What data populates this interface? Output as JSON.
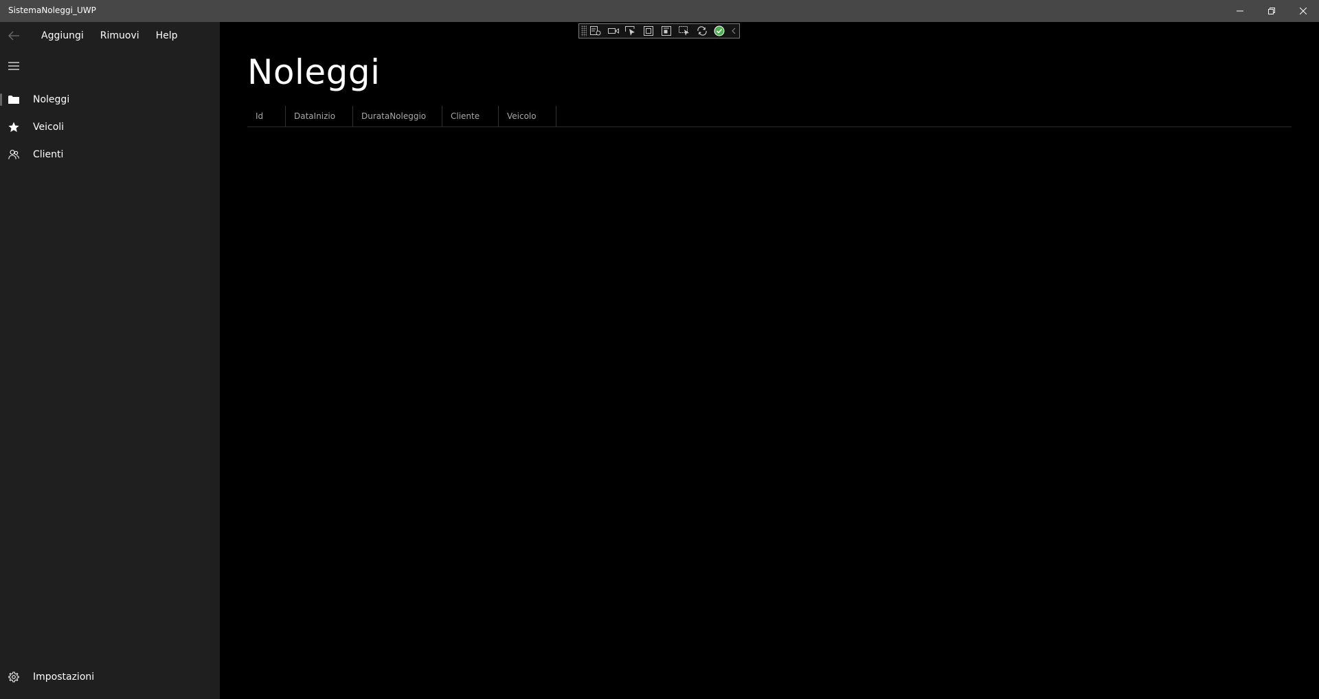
{
  "window": {
    "title": "SistemaNoleggi_UWP",
    "controls": [
      "minimize-icon",
      "restore-icon",
      "close-icon"
    ]
  },
  "menubar": {
    "items": [
      {
        "label": "Aggiungi"
      },
      {
        "label": "Rimuovi"
      },
      {
        "label": "Help"
      }
    ]
  },
  "navigation": {
    "items": [
      {
        "label": "Noleggi",
        "icon": "folder-icon",
        "selected": true
      },
      {
        "label": "Veicoli",
        "icon": "star-icon",
        "selected": false
      },
      {
        "label": "Clienti",
        "icon": "people-icon",
        "selected": false
      }
    ],
    "footer": {
      "label": "Impostazioni",
      "icon": "gear-icon"
    }
  },
  "page": {
    "title": "Noleggi",
    "grid": {
      "columns": [
        "Id",
        "DataInizio",
        "DurataNoleggio",
        "Cliente",
        "Veicolo"
      ],
      "rows": []
    }
  },
  "debug_toolbar": {
    "buttons": [
      "live-visual-tree-icon",
      "video-icon",
      "select-element-icon",
      "display-layout-adorners-icon",
      "track-focus-icon",
      "preview-selection-icon",
      "hot-reload-icon",
      "status-ok-icon",
      "collapse-chevron-icon"
    ]
  },
  "colors": {
    "titlebar": "#474747",
    "sidebar": "#1f1f1f",
    "content": "#000000",
    "status_ok": "#4caf50"
  }
}
